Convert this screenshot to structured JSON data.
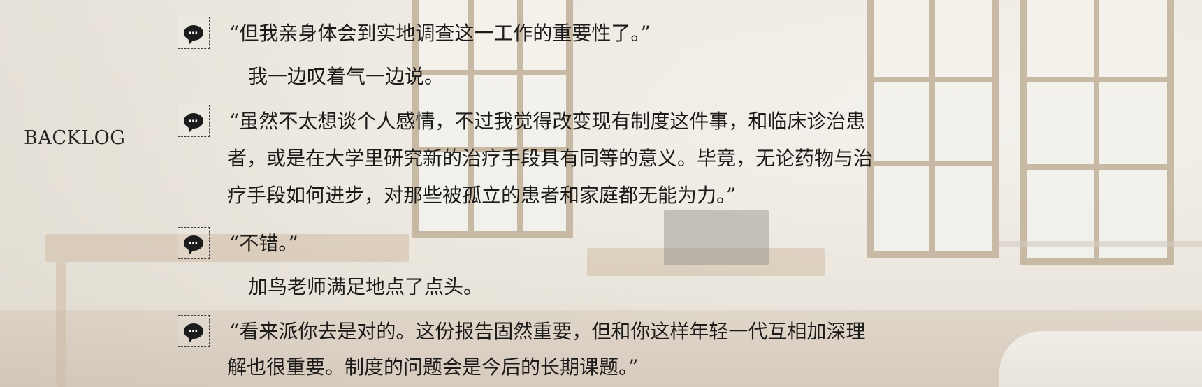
{
  "title": "BACKLOG",
  "voice_icon_dots": "▪▪▪",
  "entries": [
    {
      "lines": [
        "“但我亲身体会到实地调查这一工作的重要性了。”"
      ]
    },
    {
      "lines": [
        "我一边叹着气一边说。"
      ]
    },
    {
      "lines": [
        "“虽然不太想谈个人感情，不过我觉得改变现有制度这件事，和临床诊治患",
        "者，或是在大学里研究新的治疗手段具有同等的意义。毕竟，无论药物与治",
        "疗手段如何进步，对那些被孤立的患者和家庭都无能为力。”"
      ]
    },
    {
      "lines": [
        "“不错。”"
      ]
    },
    {
      "lines": [
        "加鸟老师满足地点了点头。"
      ]
    },
    {
      "lines": [
        "“看来派你去是对的。这份报告固然重要，但和你这样年轻一代互相加深理",
        "解也很重要。制度的问题会是今后的长期课题。”"
      ]
    }
  ]
}
